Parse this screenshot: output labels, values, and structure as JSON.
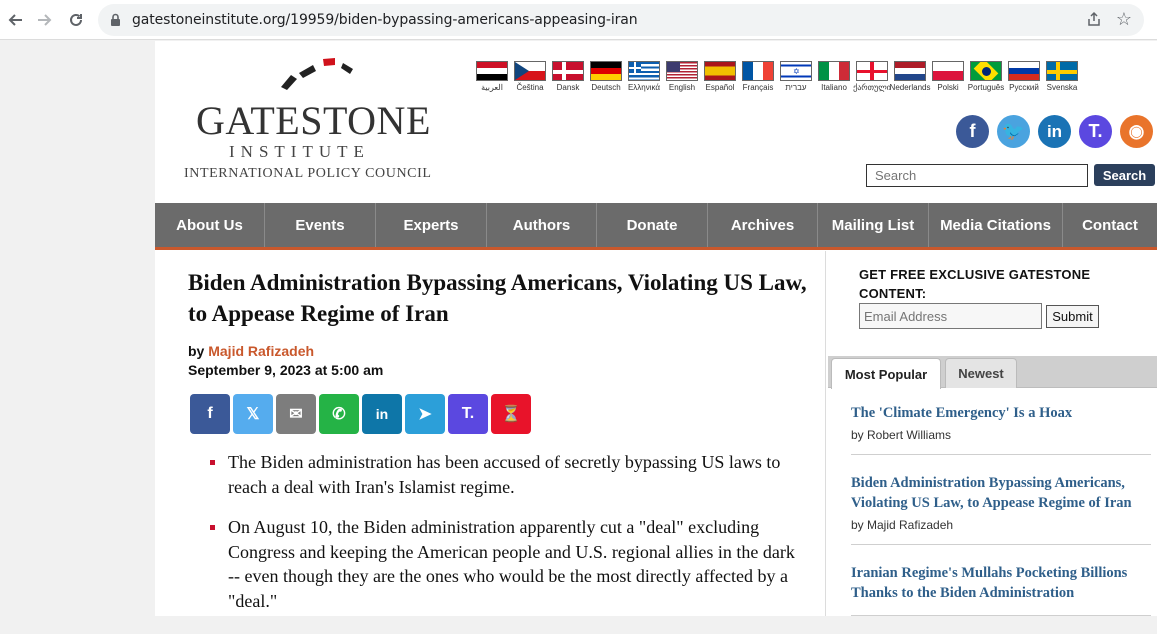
{
  "browser": {
    "url": "gatestoneinstitute.org/19959/biden-bypassing-americans-appeasing-iran"
  },
  "logo": {
    "main": "GATESTONE",
    "sub": "INSTITUTE",
    "tagline": "INTERNATIONAL POLICY COUNCIL"
  },
  "languages": [
    {
      "label": "العربية",
      "flag": "egypt"
    },
    {
      "label": "Čeština",
      "flag": "czech"
    },
    {
      "label": "Dansk",
      "flag": "denmark"
    },
    {
      "label": "Deutsch",
      "flag": "germany"
    },
    {
      "label": "Ελληνικά",
      "flag": "greece"
    },
    {
      "label": "English",
      "flag": "usa"
    },
    {
      "label": "Español",
      "flag": "spain"
    },
    {
      "label": "Français",
      "flag": "france"
    },
    {
      "label": "עברית",
      "flag": "israel"
    },
    {
      "label": "Italiano",
      "flag": "italy"
    },
    {
      "label": "ქართული",
      "flag": "georgia"
    },
    {
      "label": "Nederlands",
      "flag": "netherlands"
    },
    {
      "label": "Polski",
      "flag": "poland"
    },
    {
      "label": "Português",
      "flag": "brazil"
    },
    {
      "label": "Русский",
      "flag": "russia"
    },
    {
      "label": "Svenska",
      "flag": "sweden"
    }
  ],
  "social": [
    {
      "name": "facebook-icon",
      "glyph": "f",
      "color": "#3b5998"
    },
    {
      "name": "twitter-icon",
      "glyph": "🐦",
      "color": "#4aa3df"
    },
    {
      "name": "linkedin-icon",
      "glyph": "in",
      "color": "#1a73b5"
    },
    {
      "name": "truth-social-icon",
      "glyph": "T.",
      "color": "#5b48e0"
    },
    {
      "name": "rss-icon",
      "glyph": "◉",
      "color": "#e9742b"
    }
  ],
  "search": {
    "placeholder": "Search",
    "button": "Search"
  },
  "nav": [
    {
      "label": "About Us"
    },
    {
      "label": "Events"
    },
    {
      "label": "Experts"
    },
    {
      "label": "Authors"
    },
    {
      "label": "Donate"
    },
    {
      "label": "Archives"
    },
    {
      "label": "Mailing List"
    },
    {
      "label": "Media Citations"
    },
    {
      "label": "Contact"
    }
  ],
  "article": {
    "headline": "Biden Administration Bypassing Americans, Violating US Law, to Appease Regime of Iran",
    "by_prefix": "by",
    "author": "Majid Rafizadeh",
    "date": "September 9, 2023 at 5:00 am",
    "bullets": [
      "The Biden administration has been accused of secretly bypassing US laws to reach a deal with Iran's Islamist regime.",
      "On August 10, the Biden administration apparently cut a \"deal\" excluding Congress and keeping the American people and U.S. regional allies in the dark -- even though they are the ones who would be the most directly affected by a \"deal.\""
    ]
  },
  "share_buttons": [
    {
      "name": "share-facebook-button",
      "glyph": "f",
      "color": "#3b5998"
    },
    {
      "name": "share-x-button",
      "glyph": "𝕏",
      "color": "#55acee"
    },
    {
      "name": "share-email-button",
      "glyph": "✉",
      "color": "#7d7d7d"
    },
    {
      "name": "share-whatsapp-button",
      "glyph": "✆",
      "color": "#25b346"
    },
    {
      "name": "share-linkedin-button",
      "glyph": "in",
      "color": "#0e76a8"
    },
    {
      "name": "share-telegram-button",
      "glyph": "➤",
      "color": "#2c9fd9"
    },
    {
      "name": "share-truth-social-button",
      "glyph": "T.",
      "color": "#5b48e0"
    },
    {
      "name": "share-gettr-button",
      "glyph": "⏳",
      "color": "#e8132a"
    }
  ],
  "sidebar": {
    "promo": "GET FREE EXCLUSIVE GATESTONE CONTENT:",
    "email_placeholder": "Email Address",
    "submit": "Submit",
    "tabs": {
      "active": "Most Popular",
      "inactive": "Newest"
    },
    "popular": [
      {
        "title": "The 'Climate Emergency' Is a Hoax",
        "by": "by Robert Williams"
      },
      {
        "title": "Biden Administration Bypassing Americans, Violating US Law, to Appease Regime of Iran",
        "by": "by Majid Rafizadeh"
      },
      {
        "title": "Iranian Regime's Mullahs Pocketing Billions Thanks to the Biden Administration",
        "by": ""
      }
    ]
  }
}
